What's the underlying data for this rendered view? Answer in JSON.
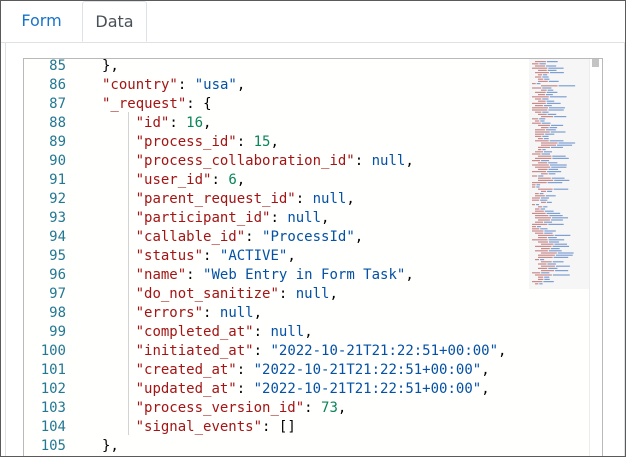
{
  "tabs": [
    {
      "label": "Form",
      "active": false
    },
    {
      "label": "Data",
      "active": true
    }
  ],
  "editor": {
    "lines": [
      {
        "n": "85",
        "indent": 1,
        "tokens": [
          {
            "t": "p",
            "v": "},"
          }
        ]
      },
      {
        "n": "86",
        "indent": 1,
        "tokens": [
          {
            "t": "key",
            "v": "\"country\""
          },
          {
            "t": "p",
            "v": ": "
          },
          {
            "t": "str",
            "v": "\"usa\""
          },
          {
            "t": "p",
            "v": ","
          }
        ]
      },
      {
        "n": "87",
        "indent": 1,
        "tokens": [
          {
            "t": "key",
            "v": "\"_request\""
          },
          {
            "t": "p",
            "v": ": {"
          }
        ]
      },
      {
        "n": "88",
        "indent": 2,
        "tokens": [
          {
            "t": "key",
            "v": "\"id\""
          },
          {
            "t": "p",
            "v": ": "
          },
          {
            "t": "num",
            "v": "16"
          },
          {
            "t": "p",
            "v": ","
          }
        ]
      },
      {
        "n": "89",
        "indent": 2,
        "tokens": [
          {
            "t": "key",
            "v": "\"process_id\""
          },
          {
            "t": "p",
            "v": ": "
          },
          {
            "t": "num",
            "v": "15"
          },
          {
            "t": "p",
            "v": ","
          }
        ]
      },
      {
        "n": "90",
        "indent": 2,
        "tokens": [
          {
            "t": "key",
            "v": "\"process_collaboration_id\""
          },
          {
            "t": "p",
            "v": ": "
          },
          {
            "t": "kw",
            "v": "null"
          },
          {
            "t": "p",
            "v": ","
          }
        ]
      },
      {
        "n": "91",
        "indent": 2,
        "tokens": [
          {
            "t": "key",
            "v": "\"user_id\""
          },
          {
            "t": "p",
            "v": ": "
          },
          {
            "t": "num",
            "v": "6"
          },
          {
            "t": "p",
            "v": ","
          }
        ]
      },
      {
        "n": "92",
        "indent": 2,
        "tokens": [
          {
            "t": "key",
            "v": "\"parent_request_id\""
          },
          {
            "t": "p",
            "v": ": "
          },
          {
            "t": "kw",
            "v": "null"
          },
          {
            "t": "p",
            "v": ","
          }
        ]
      },
      {
        "n": "93",
        "indent": 2,
        "tokens": [
          {
            "t": "key",
            "v": "\"participant_id\""
          },
          {
            "t": "p",
            "v": ": "
          },
          {
            "t": "kw",
            "v": "null"
          },
          {
            "t": "p",
            "v": ","
          }
        ]
      },
      {
        "n": "94",
        "indent": 2,
        "tokens": [
          {
            "t": "key",
            "v": "\"callable_id\""
          },
          {
            "t": "p",
            "v": ": "
          },
          {
            "t": "str",
            "v": "\"ProcessId\""
          },
          {
            "t": "p",
            "v": ","
          }
        ]
      },
      {
        "n": "95",
        "indent": 2,
        "tokens": [
          {
            "t": "key",
            "v": "\"status\""
          },
          {
            "t": "p",
            "v": ": "
          },
          {
            "t": "str",
            "v": "\"ACTIVE\""
          },
          {
            "t": "p",
            "v": ","
          }
        ]
      },
      {
        "n": "96",
        "indent": 2,
        "tokens": [
          {
            "t": "key",
            "v": "\"name\""
          },
          {
            "t": "p",
            "v": ": "
          },
          {
            "t": "str",
            "v": "\"Web Entry in Form Task\""
          },
          {
            "t": "p",
            "v": ","
          }
        ]
      },
      {
        "n": "97",
        "indent": 2,
        "tokens": [
          {
            "t": "key",
            "v": "\"do_not_sanitize\""
          },
          {
            "t": "p",
            "v": ": "
          },
          {
            "t": "kw",
            "v": "null"
          },
          {
            "t": "p",
            "v": ","
          }
        ]
      },
      {
        "n": "98",
        "indent": 2,
        "tokens": [
          {
            "t": "key",
            "v": "\"errors\""
          },
          {
            "t": "p",
            "v": ": "
          },
          {
            "t": "kw",
            "v": "null"
          },
          {
            "t": "p",
            "v": ","
          }
        ]
      },
      {
        "n": "99",
        "indent": 2,
        "tokens": [
          {
            "t": "key",
            "v": "\"completed_at\""
          },
          {
            "t": "p",
            "v": ": "
          },
          {
            "t": "kw",
            "v": "null"
          },
          {
            "t": "p",
            "v": ","
          }
        ]
      },
      {
        "n": "100",
        "indent": 2,
        "tokens": [
          {
            "t": "key",
            "v": "\"initiated_at\""
          },
          {
            "t": "p",
            "v": ": "
          },
          {
            "t": "str",
            "v": "\"2022-10-21T21:22:51+00:00\""
          },
          {
            "t": "p",
            "v": ","
          }
        ]
      },
      {
        "n": "101",
        "indent": 2,
        "tokens": [
          {
            "t": "key",
            "v": "\"created_at\""
          },
          {
            "t": "p",
            "v": ": "
          },
          {
            "t": "str",
            "v": "\"2022-10-21T21:22:51+00:00\""
          },
          {
            "t": "p",
            "v": ","
          }
        ]
      },
      {
        "n": "102",
        "indent": 2,
        "tokens": [
          {
            "t": "key",
            "v": "\"updated_at\""
          },
          {
            "t": "p",
            "v": ": "
          },
          {
            "t": "str",
            "v": "\"2022-10-21T21:22:51+00:00\""
          },
          {
            "t": "p",
            "v": ","
          }
        ]
      },
      {
        "n": "103",
        "indent": 2,
        "tokens": [
          {
            "t": "key",
            "v": "\"process_version_id\""
          },
          {
            "t": "p",
            "v": ": "
          },
          {
            "t": "num",
            "v": "73"
          },
          {
            "t": "p",
            "v": ","
          }
        ]
      },
      {
        "n": "104",
        "indent": 2,
        "tokens": [
          {
            "t": "key",
            "v": "\"signal_events\""
          },
          {
            "t": "p",
            "v": ": "
          },
          {
            "t": "p",
            "v": "[]"
          }
        ]
      },
      {
        "n": "105",
        "indent": 1,
        "tokens": [
          {
            "t": "p",
            "v": "},"
          }
        ]
      }
    ]
  }
}
